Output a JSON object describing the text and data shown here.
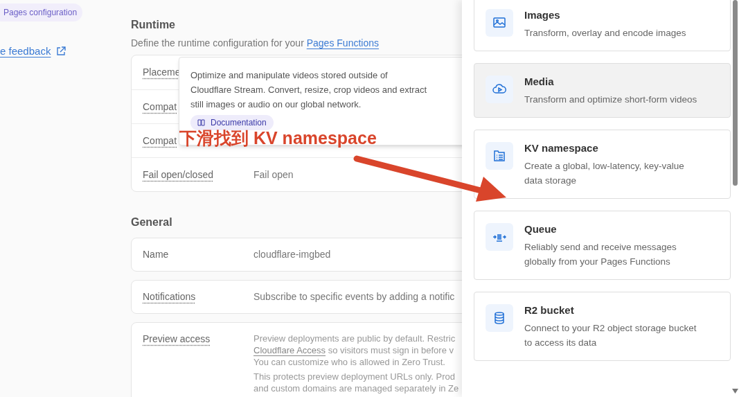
{
  "sidebar": {
    "badge": "Pages configuration",
    "feedback_link": "e feedback"
  },
  "runtime": {
    "title": "Runtime",
    "description": "Define the runtime configuration for your ",
    "description_link": "Pages Functions",
    "rows": [
      {
        "label": "Placeme"
      },
      {
        "label": "Compat"
      },
      {
        "label": "Compat"
      },
      {
        "label": "Fail open/closed",
        "value": "Fail open"
      }
    ]
  },
  "general": {
    "title": "General",
    "rows": [
      {
        "label": "Name",
        "value": "cloudflare-imgbed",
        "underlined": false
      },
      {
        "label": "Notifications",
        "value": "Subscribe to specific events by adding a notific",
        "underlined": true
      },
      {
        "label": "Preview access",
        "underlined": true,
        "paragraphs": [
          [
            {
              "text": "Preview deployments are public by default. Restric"
            },
            {
              "link": "Cloudflare Access",
              "text": " so visitors must sign in before v"
            },
            {
              "text": "You can customize who is allowed in Zero Trust."
            }
          ],
          [
            {
              "text": "This protects preview deployment URLs only. Prod"
            },
            {
              "text": "and custom domains are managed separately in Ze"
            }
          ]
        ]
      }
    ]
  },
  "tooltip": {
    "text": "Optimize and manipulate videos stored outside of Cloudflare Stream. Convert, resize, crop videos and extract still images or audio on our global network.",
    "link": "Documentation"
  },
  "annotation": {
    "text": "下滑找到 KV namespace"
  },
  "panel": {
    "cards": [
      {
        "kind": "image",
        "title": "Images",
        "description": "Transform, overlay and encode images",
        "highlighted": false
      },
      {
        "kind": "media",
        "title": "Media",
        "description": "Transform and optimize short-form videos",
        "highlighted": true
      },
      {
        "kind": "kv",
        "title": "KV namespace",
        "description": "Create a global, low-latency, key-value data storage",
        "highlighted": false
      },
      {
        "kind": "queue",
        "title": "Queue",
        "description": "Reliably send and receive messages globally from your Pages Functions",
        "highlighted": false
      },
      {
        "kind": "bucket",
        "title": "R2 bucket",
        "description": "Connect to your R2 object storage bucket to access its data",
        "highlighted": false
      }
    ]
  }
}
